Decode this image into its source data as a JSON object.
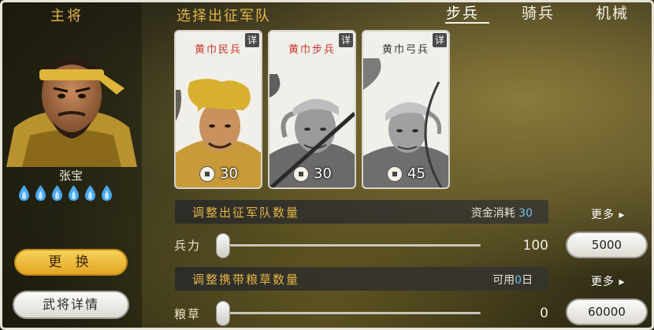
{
  "general": {
    "title": "主将",
    "name": "张宝",
    "flame_count": 6,
    "change_label": "更 换",
    "details_label": "武将详情"
  },
  "army": {
    "title": "选择出征军队",
    "tabs": [
      {
        "label": "步兵",
        "active": true
      },
      {
        "label": "骑兵",
        "active": false
      },
      {
        "label": "机械",
        "active": false
      }
    ],
    "units": [
      {
        "name": "黄巾民兵",
        "name_color": "#c8342c",
        "detail": "详",
        "cost": "30",
        "style": "color"
      },
      {
        "name": "黄巾步兵",
        "name_color": "#c8342c",
        "detail": "详",
        "cost": "30",
        "style": "gray"
      },
      {
        "name": "黄巾弓兵",
        "name_color": "#333333",
        "detail": "详",
        "cost": "45",
        "style": "gray"
      }
    ]
  },
  "troops": {
    "band_label": "调整出征军队数量",
    "cost_label": "资金消耗",
    "cost_value": "30",
    "row_label": "兵力",
    "slider_value": "100",
    "slider_fraction": 0.0,
    "more_label": "更多",
    "max_button": "5000"
  },
  "supplies": {
    "band_label": "调整携带粮草数量",
    "avail_prefix": "可用",
    "avail_value": "0",
    "avail_suffix": "日",
    "row_label": "粮草",
    "slider_value": "0",
    "slider_fraction": 0.0,
    "more_label": "更多",
    "max_button": "60000"
  },
  "colors": {
    "gold": "#e3b646",
    "accent_blue": "#6fc0ee",
    "flame_blue": "#4aa8f0"
  }
}
